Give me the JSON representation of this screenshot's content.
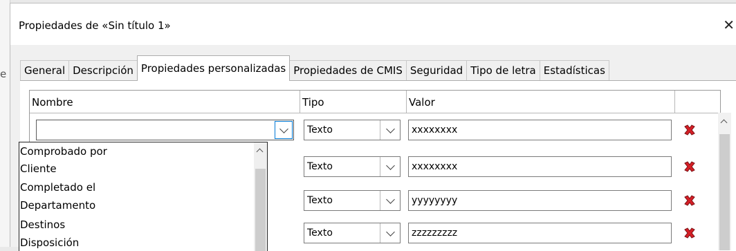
{
  "window": {
    "title": "Propiedades de «Sin título 1»",
    "close_label": "✕"
  },
  "tabs": [
    {
      "label": "General"
    },
    {
      "label": "Descripción"
    },
    {
      "label": "Propiedades personalizadas",
      "active": true
    },
    {
      "label": "Propiedades de CMIS"
    },
    {
      "label": "Seguridad"
    },
    {
      "label": "Tipo de letra"
    },
    {
      "label": "Estadísticas"
    }
  ],
  "table": {
    "headers": [
      "Nombre",
      "Tipo",
      "Valor"
    ],
    "rows": [
      {
        "name": "",
        "type": "Texto",
        "value": "xxxxxxxx"
      },
      {
        "name": "",
        "type": "Texto",
        "value": "xxxxxxxx"
      },
      {
        "name": "",
        "type": "Texto",
        "value": "yyyyyyyy"
      },
      {
        "name": "",
        "type": "Texto",
        "value": "zzzzzzzzz"
      }
    ]
  },
  "dropdown": {
    "items": [
      "Comprobado por",
      "Cliente",
      "Completado el",
      "Departamento",
      "Destinos",
      "Disposición"
    ]
  },
  "background_text": {
    "left_edge": "e"
  },
  "icons": {
    "delete": "red-x-icon",
    "dropdown": "chevron-down-icon",
    "scroll_up": "chevron-up-icon"
  },
  "colors": {
    "delete": "#d61f26",
    "focus": "#0078d4"
  }
}
